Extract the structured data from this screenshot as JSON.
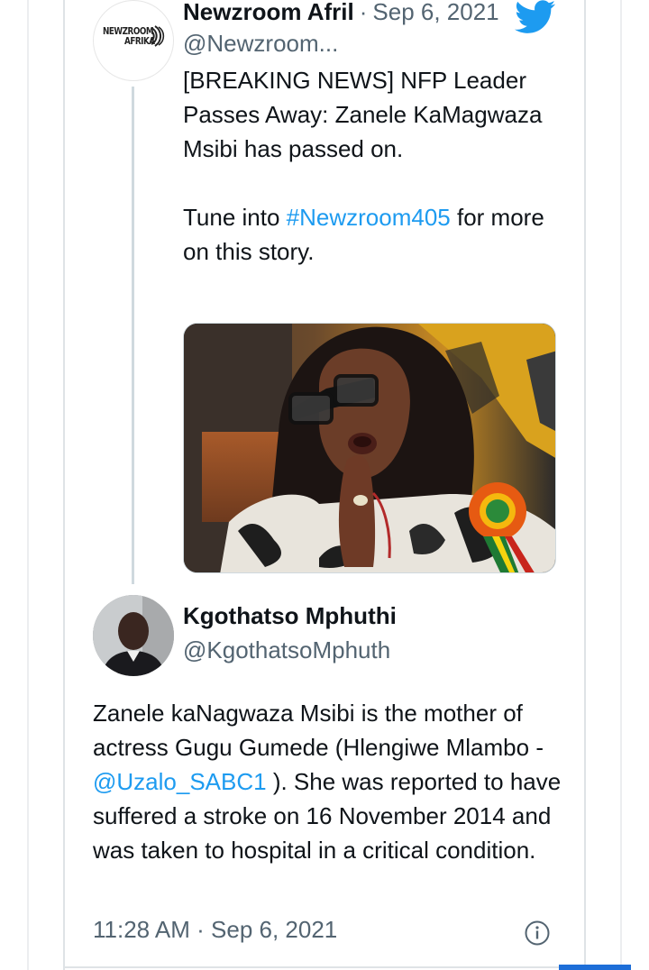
{
  "quoted_tweet": {
    "display_name": "Newzroom Afril",
    "separator": "·",
    "date": "Sep 6, 2021",
    "handle": "@Newzroom...",
    "avatar_logo_line1": "NEWZROOM",
    "avatar_logo_line2": "AFRIKA",
    "body_line1": "[BREAKING NEWS] NFP Leader Passes Away: Zanele KaMagwaza Msibi has passed on.",
    "body_line2_before": "Tune into ",
    "body_hashtag": "#Newzroom405",
    "body_line2_after": " for more on this story.",
    "platform_icon": "twitter-bird-icon"
  },
  "reply_tweet": {
    "display_name": "Kgothatso Mphuthi",
    "handle": "@KgothatsoMphuth",
    "body_before": "Zanele kaNagwaza Msibi is the mother of actress Gugu Gumede (Hlengiwe Mlambo - ",
    "body_mention": "@Uzalo_SABC1",
    "body_after": " ). She was reported to have suffered a stroke on 16 November 2014 and was taken to hospital in a critical condition.",
    "timestamp": "11:28 AM · Sep 6, 2021",
    "info_icon": "info-icon"
  },
  "colors": {
    "link": "#1d9bf0",
    "secondary_text": "#536471",
    "primary_text": "#0f1419",
    "twitter_blue": "#1d9bf0"
  }
}
